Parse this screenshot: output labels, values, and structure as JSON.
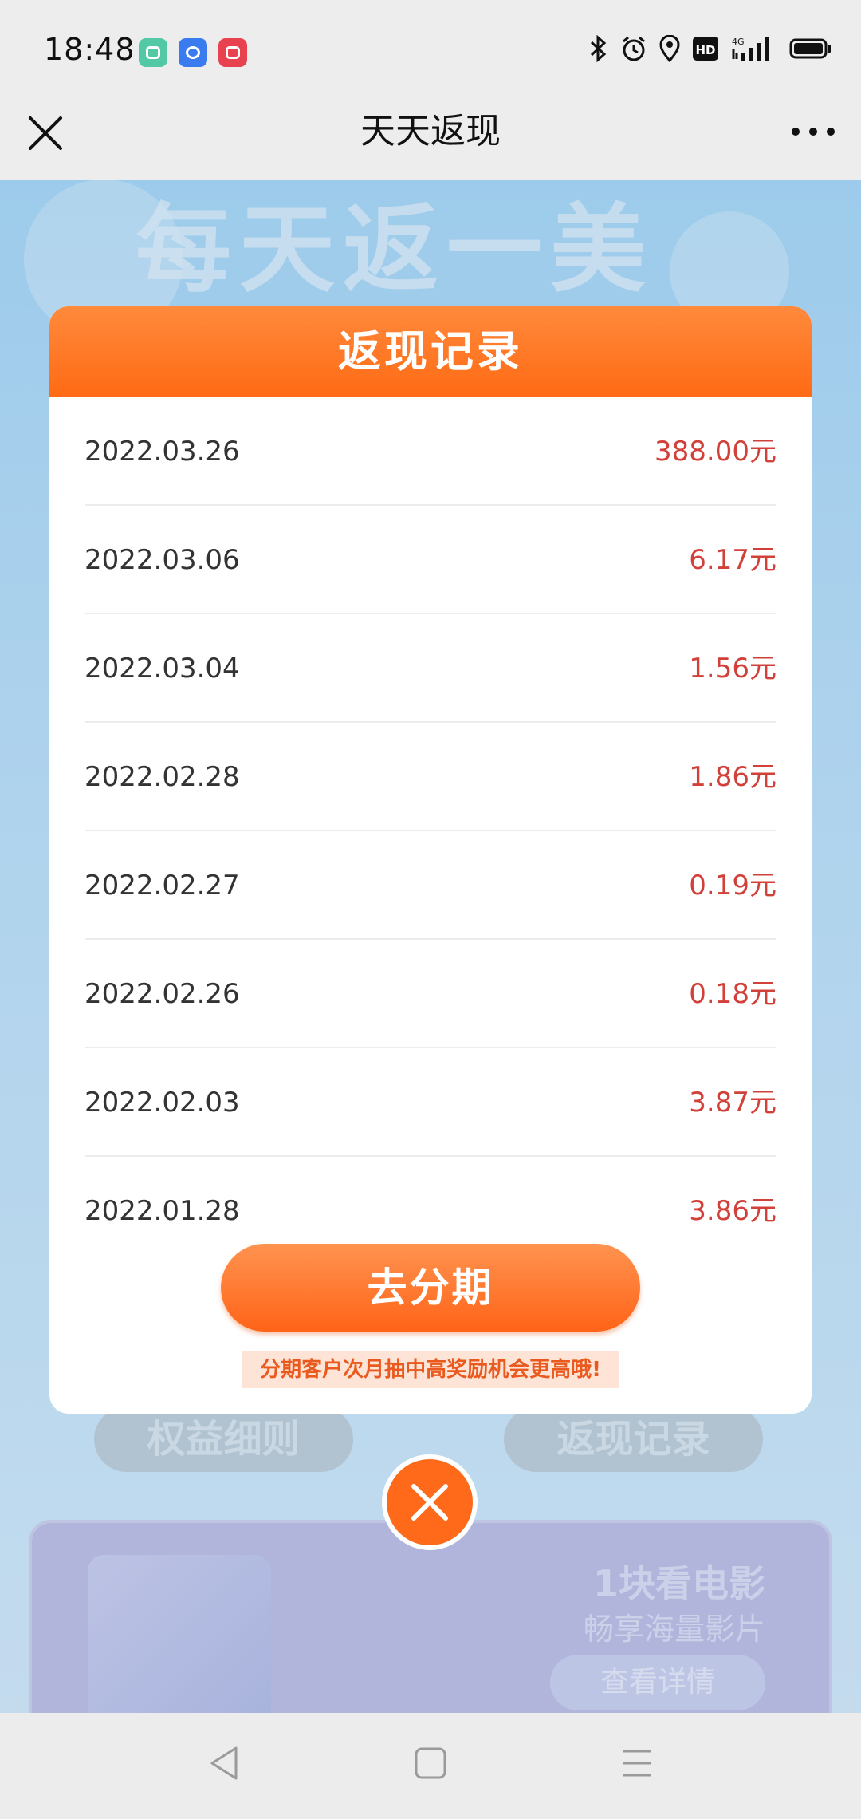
{
  "status_bar": {
    "time": "18:48",
    "apps": [
      "multi-window-icon",
      "chat-icon",
      "video-icon"
    ],
    "system_icons": [
      "bluetooth-icon",
      "alarm-icon",
      "location-icon",
      "hd-icon",
      "signal-4g-icon",
      "battery-icon"
    ],
    "hd_label": "HD",
    "network_label": "4G"
  },
  "nav": {
    "title": "天天返现"
  },
  "background": {
    "heading": "每天返一美",
    "rules_button": "权益细则",
    "records_button": "返现记录",
    "card_title": "1块看电影",
    "card_subtitle": "畅享海量影片",
    "card_button": "查看详情"
  },
  "modal": {
    "title": "返现记录",
    "records": [
      {
        "date": "2022.03.26",
        "amount": "388.00元"
      },
      {
        "date": "2022.03.06",
        "amount": "6.17元"
      },
      {
        "date": "2022.03.04",
        "amount": "1.56元"
      },
      {
        "date": "2022.02.28",
        "amount": "1.86元"
      },
      {
        "date": "2022.02.27",
        "amount": "0.19元"
      },
      {
        "date": "2022.02.26",
        "amount": "0.18元"
      },
      {
        "date": "2022.02.03",
        "amount": "3.87元"
      },
      {
        "date": "2022.01.28",
        "amount": "3.86元"
      }
    ],
    "action_button": "去分期",
    "tip": "分期客户次月抽中高奖励机会更高哦!"
  },
  "colors": {
    "accent_orange": "#ff6a14",
    "amount_red": "#d2403a"
  }
}
